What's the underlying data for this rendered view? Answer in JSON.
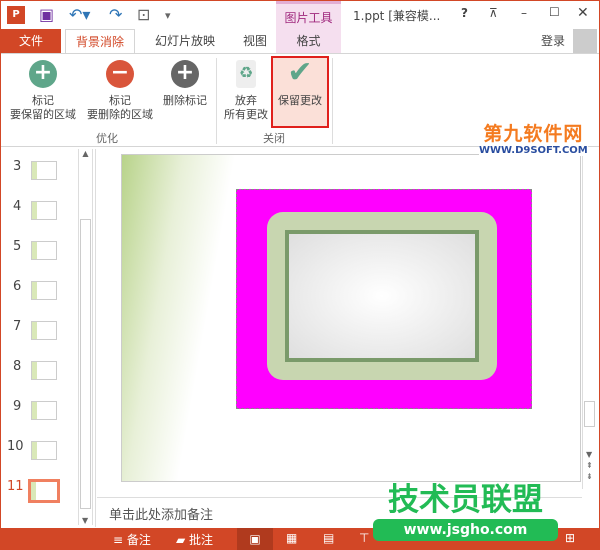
{
  "titlebar": {
    "app_icon": "powerpoint-icon",
    "context_tab": "图片工具",
    "title": "1.ppt [兼容模...",
    "help": "?",
    "icons": [
      "save-icon",
      "undo-icon",
      "redo-icon",
      "slideshow-icon",
      "customize-icon",
      "ribbon-display-icon",
      "minimize-icon",
      "maximize-icon",
      "close-icon"
    ]
  },
  "tabs": {
    "file": "文件",
    "items": [
      "背景消除",
      "幻灯片放映",
      "视图",
      "格式"
    ],
    "active": "背景消除",
    "signin": "登录"
  },
  "ribbon": {
    "buttons": [
      {
        "line1": "标记",
        "line2": "要保留的区域"
      },
      {
        "line1": "标记",
        "line2": "要删除的区域"
      },
      {
        "line1": "删除标记",
        "line2": ""
      },
      {
        "line1": "放弃",
        "line2": "所有更改"
      },
      {
        "line1": "保留更改",
        "line2": ""
      }
    ],
    "groups": [
      "优化",
      "关闭"
    ]
  },
  "slides": {
    "numbers": [
      "3",
      "4",
      "5",
      "6",
      "7",
      "8",
      "9",
      "10",
      "11"
    ],
    "selected": "11"
  },
  "notes": {
    "placeholder": "单击此处添加备注"
  },
  "status": {
    "notes": "备注",
    "comments": "批注"
  },
  "watermarks": {
    "top": "第九软件网",
    "top_url": "WWW.D9SOFT.COM",
    "bottom": "技术员联盟",
    "bottom_url": "www.jsgho.com"
  },
  "colors": {
    "accent": "#d24726",
    "magenta": "#ff00ff",
    "context": "#f5dfef"
  }
}
